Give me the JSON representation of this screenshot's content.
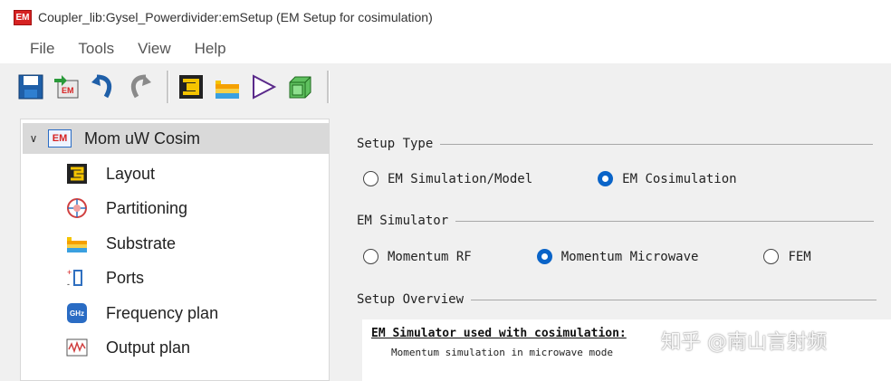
{
  "window": {
    "title": "Coupler_lib:Gysel_Powerdivider:emSetup (EM Setup for cosimulation)",
    "app_badge": "EM"
  },
  "menu": [
    "File",
    "Tools",
    "View",
    "Help"
  ],
  "toolbar": [
    "save-icon",
    "em-export-icon",
    "undo-icon",
    "redo-icon",
    "layout-icon",
    "substrate-icon",
    "port-triangle-icon",
    "3d-box-icon"
  ],
  "tree": {
    "root": {
      "badge": "EM",
      "label": "Mom uW Cosim"
    },
    "items": [
      {
        "label": "Layout",
        "icon": "layout-icon"
      },
      {
        "label": "Partitioning",
        "icon": "partitioning-icon"
      },
      {
        "label": "Substrate",
        "icon": "substrate-icon"
      },
      {
        "label": "Ports",
        "icon": "ports-icon"
      },
      {
        "label": "Frequency plan",
        "icon": "frequency-plan-icon",
        "badge": "GHz"
      },
      {
        "label": "Output plan",
        "icon": "output-plan-icon"
      }
    ]
  },
  "setup_type": {
    "title": "Setup Type",
    "options": [
      {
        "label": "EM Simulation/Model",
        "checked": false
      },
      {
        "label": "EM Cosimulation",
        "checked": true
      }
    ]
  },
  "em_simulator": {
    "title": "EM Simulator",
    "options": [
      {
        "label": "Momentum RF",
        "checked": false
      },
      {
        "label": "Momentum Microwave",
        "checked": true
      },
      {
        "label": "FEM",
        "checked": false
      }
    ]
  },
  "overview": {
    "title": "Setup Overview",
    "heading": "EM Simulator used with cosimulation:",
    "line1": "Momentum simulation in microwave mode"
  },
  "watermark": "知乎 @南山言射频",
  "colors": {
    "accent": "#0a64c8",
    "em_red": "#d62222"
  }
}
